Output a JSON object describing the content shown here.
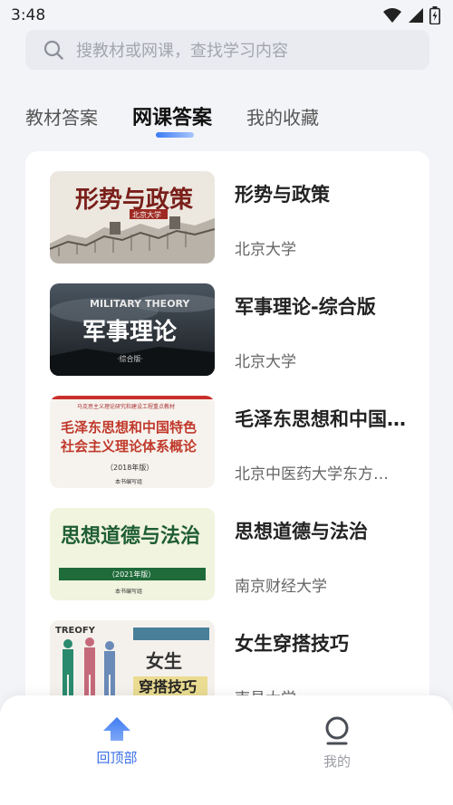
{
  "status": {
    "time": "3:48"
  },
  "search": {
    "placeholder": "搜教材或网课，查找学习内容"
  },
  "tabs": [
    {
      "label": "教材答案",
      "active": false
    },
    {
      "label": "网课答案",
      "active": true
    },
    {
      "label": "我的收藏",
      "active": false
    }
  ],
  "courses": [
    {
      "title": "形势与政策",
      "school": "北京大学",
      "cover_text": "形势与政策",
      "cover_sub": "北京大学"
    },
    {
      "title": "军事理论-综合版",
      "school": "北京大学",
      "cover_text": "军事理论",
      "cover_top": "MILITARY THEORY",
      "cover_sub": "·综合版·"
    },
    {
      "title": "毛泽东思想和中国特色社会主义理论体系概论",
      "school": "北京中医药大学东方学院",
      "cover_top": "马克思主义理论研究和建设工程重点教材",
      "cover_line1": "毛泽东思想和中国特色",
      "cover_line2": "社会主义理论体系概论",
      "cover_sub": "（2018年版）",
      "cover_foot": "本书编写组"
    },
    {
      "title": "思想道德与法治",
      "school": "南京财经大学",
      "cover_text": "思想道德与法治",
      "cover_sub": "（2021年版）",
      "cover_foot": "本书编写组"
    },
    {
      "title": "女生穿搭技巧",
      "school": "南昌大学",
      "cover_top": "TREOFY",
      "cover_line1": "女生",
      "cover_line2": "穿搭技巧"
    }
  ],
  "bottom_nav": [
    {
      "label": "回顶部",
      "icon": "arrow-up-icon",
      "active": true,
      "color": "#3b6fe8"
    },
    {
      "label": "我的",
      "icon": "profile-icon",
      "active": false,
      "color": "#9a9ca3"
    }
  ]
}
